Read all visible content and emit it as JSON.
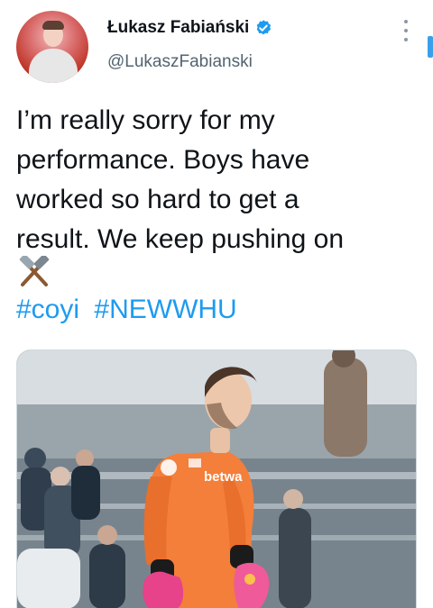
{
  "tweet": {
    "display_name": "Łukasz Fabiański",
    "handle": "@LukaszFabianski",
    "text_lines": [
      "I’m really sorry for my",
      "performance. Boys have",
      "worked so hard to get a",
      "result. We keep pushing on"
    ],
    "hashtags": [
      "#coyi",
      "#NEWWHU"
    ]
  },
  "photo": {
    "shirt_sponsor": "betwa"
  },
  "icons": {
    "verified": "verified-badge-icon",
    "emoji": "crossed-hammers-icon",
    "more": "more-options-icon"
  },
  "colors": {
    "link": "#1d9bf0",
    "secondary_text": "#536471",
    "verified": "#1d9bf0",
    "kit_orange": "#f37f3b"
  }
}
